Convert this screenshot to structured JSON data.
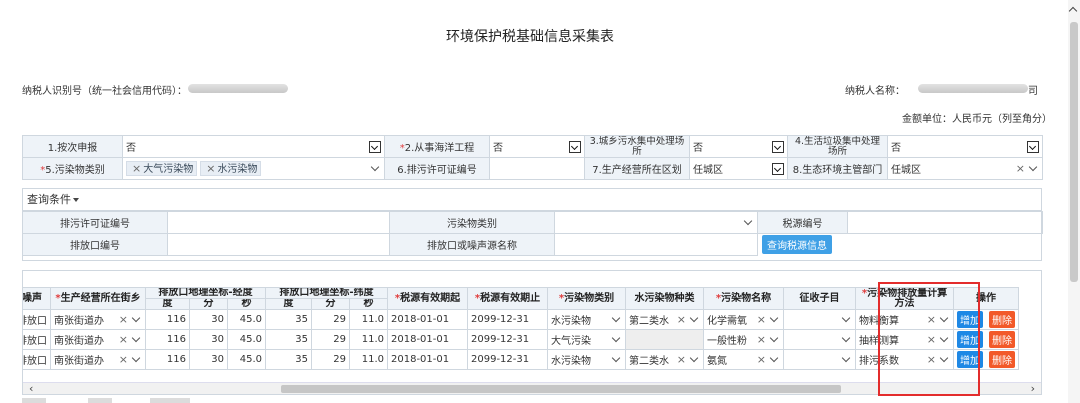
{
  "title": "环境保护税基础信息采集表",
  "taxpayer": {
    "id_label": "纳税人识别号（统一社会信用代码）：",
    "name_label": "纳税人名称：",
    "name_tail": "司"
  },
  "currency_note": "金额单位：人民币元（列至角分）",
  "basic_info": {
    "row1": [
      {
        "label": "1.按次申报",
        "required": false,
        "value": "否"
      },
      {
        "label": "2.从事海洋工程",
        "required": true,
        "value": "否"
      },
      {
        "label": "3.城乡污水集中处理场所",
        "required": false,
        "value": "否"
      },
      {
        "label": "4.生活垃圾集中处理场所",
        "required": false,
        "value": "否"
      }
    ],
    "row2": [
      {
        "label": "5.污染物类别",
        "required": true,
        "tags": [
          "大气污染物",
          "水污染物"
        ]
      },
      {
        "label": "6.排污许可证编号",
        "required": false,
        "value": ""
      },
      {
        "label": "7.生产经营所在区划",
        "required": false,
        "value": "任城区"
      },
      {
        "label": "8.生态环境主管部门",
        "required": false,
        "value": "任城区"
      }
    ]
  },
  "query": {
    "header": "查询条件",
    "fields": {
      "permit_no": "排污许可证编号",
      "pollutant_type": "污染物类别",
      "tax_source_no": "税源编号",
      "outlet_no": "排放口编号",
      "outlet_name": "排放口或噪声源名称"
    },
    "button": "查询税源信息"
  },
  "grid": {
    "headers": {
      "noise": "噪声",
      "street": "生产经营所在街乡",
      "lon_group": "排放口地理坐标-经度",
      "lat_group": "排放口地理坐标-纬度",
      "deg": "度",
      "min": "分",
      "sec": "秒",
      "valid_from": "税源有效期起",
      "valid_to": "税源有效期止",
      "pollutant_type": "污染物类别",
      "water_kind": "水污染物种类",
      "pollutant_name": "污染物名称",
      "item": "征收子目",
      "calc_method": "污染物排放量计算方法",
      "ops": "操作"
    },
    "rows": [
      {
        "noise": "排放口",
        "street": "南张街道办",
        "lon": [
          "116",
          "30",
          "45.0"
        ],
        "lat": [
          "35",
          "29",
          "11.0"
        ],
        "from": "2018-01-01",
        "to": "2099-12-31",
        "type": "水污染物",
        "water": "第二类水",
        "name": "化学需氧",
        "item": "",
        "method": "物料衡算"
      },
      {
        "noise": "排放口",
        "street": "南张街道办",
        "lon": [
          "116",
          "30",
          "45.0"
        ],
        "lat": [
          "35",
          "29",
          "11.0"
        ],
        "from": "2018-01-01",
        "to": "2099-12-31",
        "type": "大气污染",
        "water": "",
        "name": "一般性粉",
        "item": "",
        "method": "抽样测算"
      },
      {
        "noise": "排放口",
        "street": "南张街道办",
        "lon": [
          "116",
          "30",
          "45.0"
        ],
        "lat": [
          "35",
          "29",
          "11.0"
        ],
        "from": "2018-01-01",
        "to": "2099-12-31",
        "type": "水污染物",
        "water": "第二类水",
        "name": "氨氮",
        "item": "",
        "method": "排污系数"
      }
    ],
    "add_label": "增加",
    "delete_label": "删除"
  },
  "colors": {
    "required": "#e03c3c",
    "add_button": "#1e88e5",
    "delete_button": "#f25a2a",
    "query_button": "#3fa0e6",
    "highlight_box": "#e32c2c"
  }
}
